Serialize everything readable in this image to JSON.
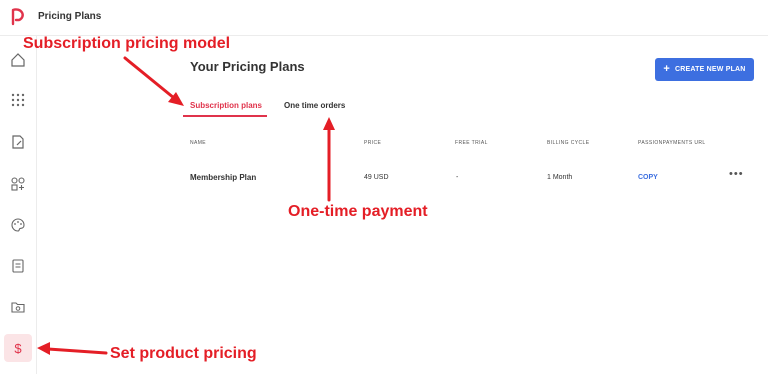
{
  "app": {
    "title": "Pricing Plans"
  },
  "page": {
    "title": "Your Pricing Plans",
    "create_button": "CREATE NEW PLAN"
  },
  "tabs": [
    {
      "label": "Subscription plans",
      "active": true
    },
    {
      "label": "One time orders",
      "active": false
    }
  ],
  "table": {
    "headers": [
      "NAME",
      "PRICE",
      "FREE TRIAL",
      "BILLING CYCLE",
      "PASSIONPAYMENTS URL"
    ],
    "rows": [
      {
        "name": "Membership Plan",
        "price": "49 USD",
        "free_trial": "-",
        "billing_cycle": "1 Month",
        "url": "COPY",
        "more": "•••"
      }
    ]
  },
  "sidebar": {
    "items": [
      {
        "icon": "home-icon"
      },
      {
        "icon": "apps-grid-icon"
      },
      {
        "icon": "edit-document-icon"
      },
      {
        "icon": "add-widget-icon"
      },
      {
        "icon": "palette-icon"
      },
      {
        "icon": "notes-icon"
      },
      {
        "icon": "folder-icon"
      },
      {
        "icon": "dollar-icon",
        "active": true
      }
    ]
  },
  "annotations": {
    "subscription": "Subscription pricing model",
    "one_time": "One-time payment",
    "product_pricing": "Set product pricing"
  },
  "colors": {
    "accent": "#e0334b",
    "primary": "#3d6fe0",
    "annotation": "#e41e26"
  }
}
